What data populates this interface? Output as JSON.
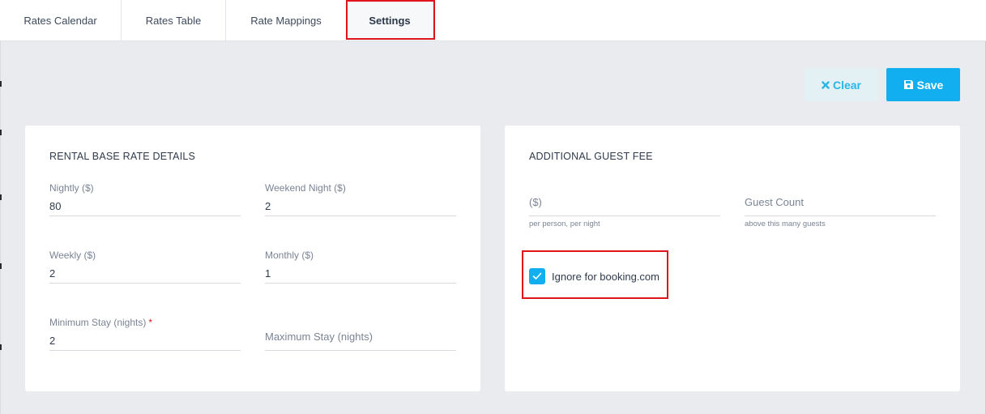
{
  "tabs": [
    {
      "label": "Rates Calendar",
      "active": false
    },
    {
      "label": "Rates Table",
      "active": false
    },
    {
      "label": "Rate Mappings",
      "active": false
    },
    {
      "label": "Settings",
      "active": true
    }
  ],
  "toolbar": {
    "clear_label": "Clear",
    "clear_icon": "close-icon",
    "save_label": "Save",
    "save_icon": "floppy-disk-icon"
  },
  "base_rate": {
    "title": "RENTAL BASE RATE DETAILS",
    "fields": {
      "nightly": {
        "label": "Nightly ($)",
        "value": "80"
      },
      "weekend_night": {
        "label": "Weekend Night ($)",
        "value": "2"
      },
      "weekly": {
        "label": "Weekly ($)",
        "value": "2"
      },
      "monthly": {
        "label": "Monthly ($)",
        "value": "1"
      },
      "min_stay": {
        "label": "Minimum Stay (nights)",
        "required_mark": "*",
        "value": "2"
      },
      "max_stay": {
        "label": "Maximum Stay (nights)",
        "value": ""
      }
    }
  },
  "guest_fee": {
    "title": "ADDITIONAL GUEST FEE",
    "fee": {
      "placeholder": "($)",
      "value": "",
      "hint": "per person, per night"
    },
    "guest_count": {
      "placeholder": "Guest Count",
      "value": "",
      "hint": "above this many guests"
    },
    "ignore_booking": {
      "label": "Ignore for booking.com",
      "checked": true
    }
  },
  "colors": {
    "accent": "#11aff0",
    "highlight": "#e0141b"
  }
}
